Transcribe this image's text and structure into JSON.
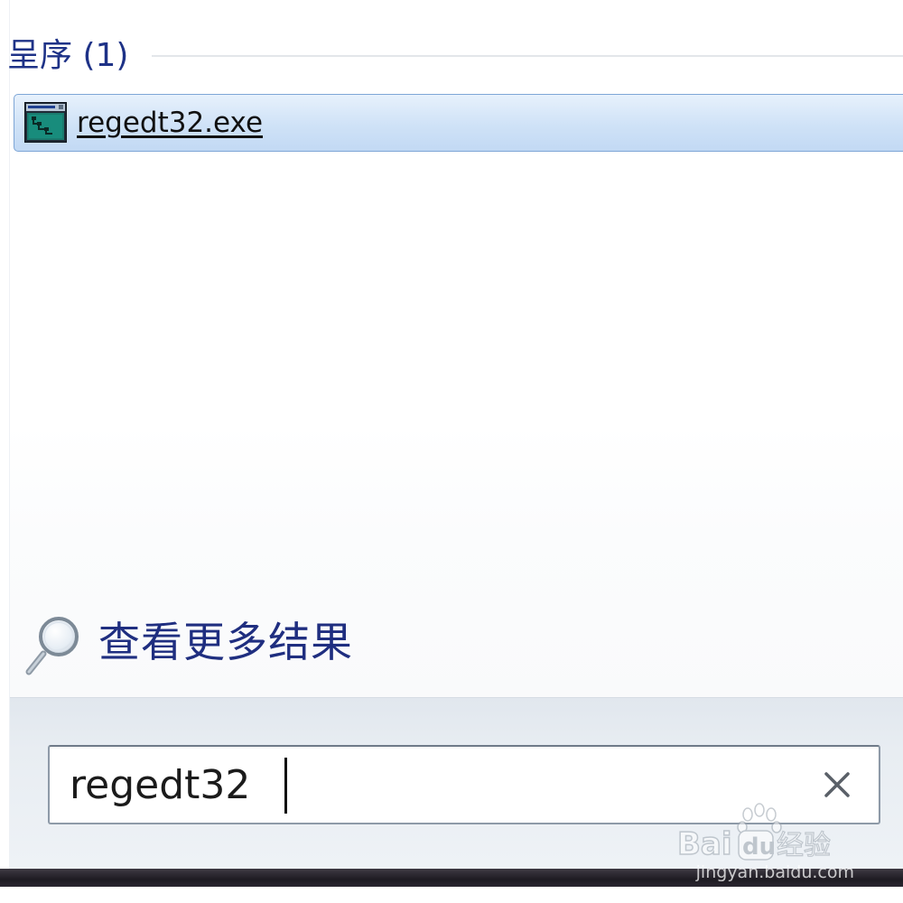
{
  "results_group": {
    "title": "呈序 (1)",
    "items": [
      {
        "label": "regedt32.exe",
        "icon": "registry-editor-icon",
        "selected": true
      }
    ]
  },
  "see_more": {
    "label": "查看更多结果",
    "icon": "magnifier-icon"
  },
  "search": {
    "value": "regedt32",
    "clear_icon": "close-icon"
  },
  "watermark": {
    "brand": "Baidu经验",
    "url": "jingyan.baidu.com"
  },
  "colors": {
    "header_text": "#1e3287",
    "selection_border": "#7ea6d6",
    "selection_fill": "#cfe2f7",
    "link_text": "#1f2e80",
    "panel_bg": "#e8edf2",
    "taskbar": "#1e1b22"
  }
}
